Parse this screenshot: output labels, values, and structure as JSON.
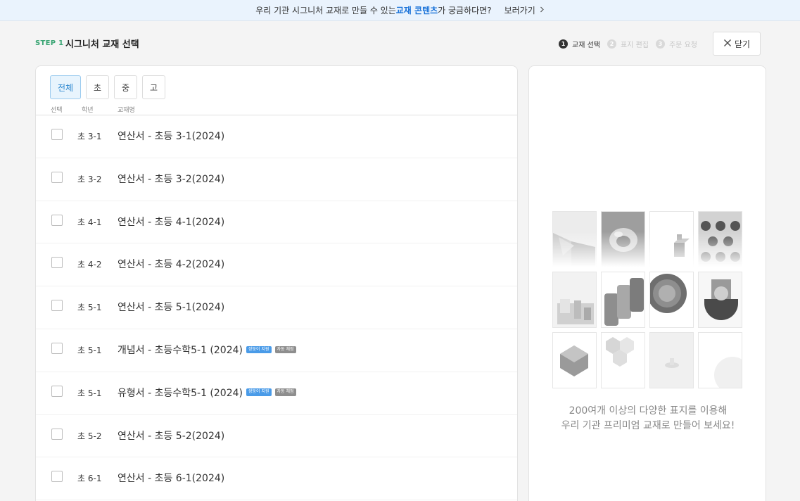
{
  "banner": {
    "text_before": "우리 기관 시그니처 교재로 만들 수 있는 ",
    "highlight": "교재 콘텐츠",
    "text_after": "가 궁금하다면?",
    "link_label": "보러가기",
    "link_icon": "chevron-right-icon"
  },
  "header": {
    "step_label": "STEP 1",
    "title": "시그니처 교재 선택",
    "steps": [
      {
        "num": "1",
        "label": "교재 선택",
        "active": true
      },
      {
        "num": "2",
        "label": "표지 편집",
        "active": false
      },
      {
        "num": "3",
        "label": "주문 요청",
        "active": false
      }
    ],
    "close_label": "닫기",
    "close_icon": "close-icon"
  },
  "filters": [
    {
      "label": "전체",
      "active": true
    },
    {
      "label": "초",
      "active": false
    },
    {
      "label": "중",
      "active": false
    },
    {
      "label": "고",
      "active": false
    }
  ],
  "table": {
    "columns": [
      "선택",
      "학년",
      "교재명"
    ],
    "rows": [
      {
        "grade": "초 3-1",
        "name": "연산서 - 초등 3-1(2024)",
        "badges": []
      },
      {
        "grade": "초 3-2",
        "name": "연산서 - 초등 3-2(2024)",
        "badges": []
      },
      {
        "grade": "초 4-1",
        "name": "연산서 - 초등 4-1(2024)",
        "badges": []
      },
      {
        "grade": "초 4-2",
        "name": "연산서 - 초등 4-2(2024)",
        "badges": []
      },
      {
        "grade": "초 5-1",
        "name": "연산서 - 초등 5-1(2024)",
        "badges": []
      },
      {
        "grade": "초 5-1",
        "name": "개념서 - 초등수학5-1 (2024)",
        "badges": [
          "쌍둥이 지원",
          "자동 채점"
        ]
      },
      {
        "grade": "초 5-1",
        "name": "유형서 - 초등수학5-1 (2024)",
        "badges": [
          "쌍둥이 지원",
          "자동 채점"
        ]
      },
      {
        "grade": "초 5-2",
        "name": "연산서 - 초등 5-2(2024)",
        "badges": []
      },
      {
        "grade": "초 6-1",
        "name": "연산서 - 초등 6-1(2024)",
        "badges": []
      }
    ]
  },
  "promo": {
    "line1": "200여개 이상의 다양한 표지를 이용해",
    "line2": "우리 기관 프리미엄 교재로 만들어 보세요!"
  },
  "colors": {
    "accent_blue": "#1a73d9",
    "step_green": "#3aa574",
    "badge_blue": "#4a9be8",
    "badge_gray": "#8e8e8e",
    "banner_bg": "#eaf3fd"
  }
}
